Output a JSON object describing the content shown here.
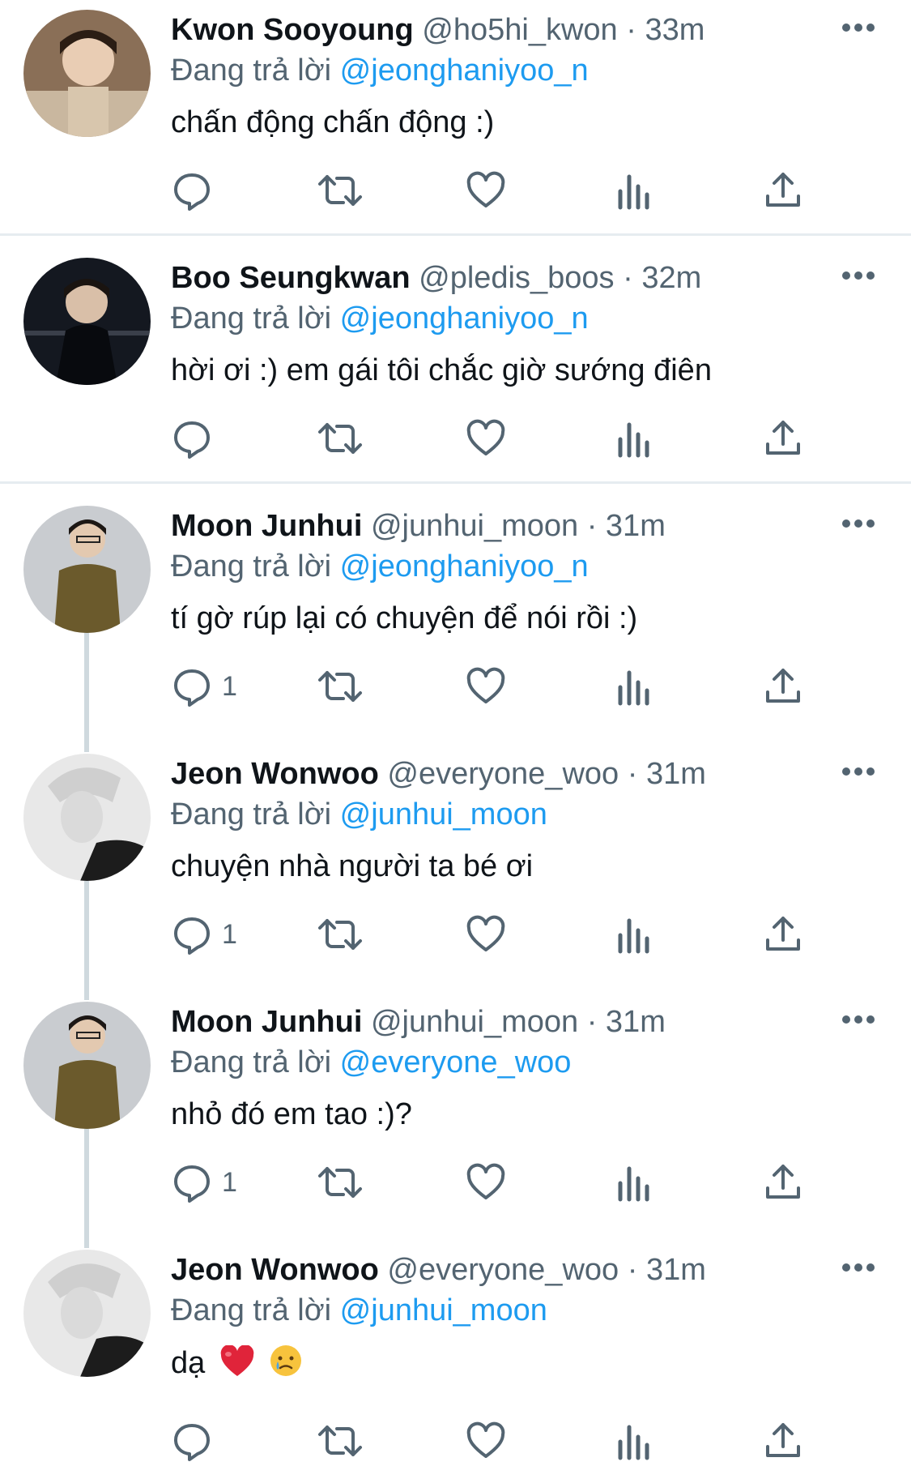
{
  "replying_label": "Đang trả lời",
  "colors": {
    "accent": "#1d9bf0",
    "secondary_text": "#536471",
    "thread_line": "#cfd9de"
  },
  "icons": [
    "more-icon",
    "reply-icon",
    "retweet-icon",
    "like-icon",
    "views-icon",
    "share-icon"
  ],
  "tweets": [
    {
      "name": "Kwon Sooyoung",
      "handle": "@ho5hi_kwon",
      "dot": "·",
      "time": "33m",
      "replying_to": "@jeonghaniyoo_n",
      "text": "chấn động chấn động :)",
      "reply_count": ""
    },
    {
      "name": "Boo Seungkwan",
      "handle": "@pledis_boos",
      "dot": "·",
      "time": "32m",
      "replying_to": "@jeonghaniyoo_n",
      "text": "hời ơi :) em gái tôi chắc giờ sướng điên",
      "reply_count": ""
    },
    {
      "name": "Moon Junhui",
      "handle": "@junhui_moon",
      "dot": "·",
      "time": "31m",
      "replying_to": "@jeonghaniyoo_n",
      "text": "tí gờ rúp lại có chuyện để nói rồi :)",
      "reply_count": "1"
    },
    {
      "name": "Jeon Wonwoo",
      "handle": "@everyone_woo",
      "dot": "·",
      "time": "31m",
      "replying_to": "@junhui_moon",
      "text": "chuyện nhà người ta bé ơi",
      "reply_count": "1"
    },
    {
      "name": "Moon Junhui",
      "handle": "@junhui_moon",
      "dot": "·",
      "time": "31m",
      "replying_to": "@everyone_woo",
      "text": "nhỏ đó em tao :)?",
      "reply_count": "1"
    },
    {
      "name": "Jeon Wonwoo",
      "handle": "@everyone_woo",
      "dot": "·",
      "time": "31m",
      "replying_to": "@junhui_moon",
      "text": "dạ",
      "reply_count": "",
      "emojis": [
        "heart-emoji",
        "crying-face-emoji"
      ]
    }
  ]
}
